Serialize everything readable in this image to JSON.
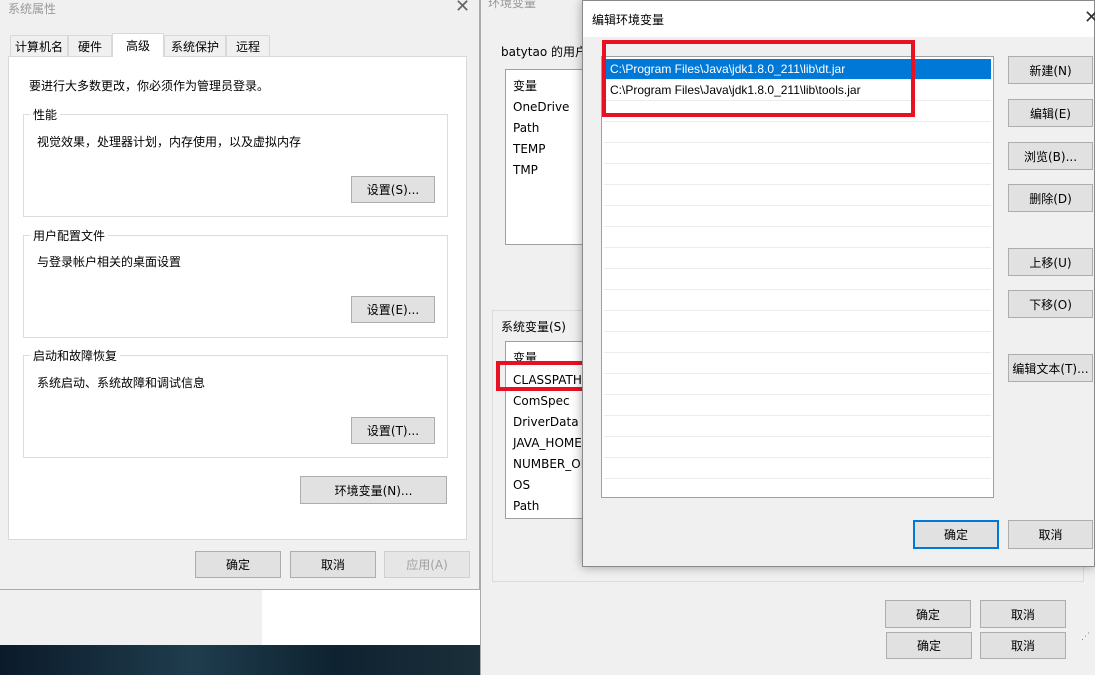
{
  "sys_props": {
    "title": "系统属性",
    "tabs": [
      "计算机名",
      "硬件",
      "高级",
      "系统保护",
      "远程"
    ],
    "notice": "要进行大多数更改，你必须作为管理员登录。",
    "performance": {
      "title": "性能",
      "desc": "视觉效果，处理器计划，内存使用，以及虚拟内存",
      "button": "设置(S)..."
    },
    "profile": {
      "title": "用户配置文件",
      "desc": "与登录帐户相关的桌面设置",
      "button": "设置(E)..."
    },
    "startup": {
      "title": "启动和故障恢复",
      "desc": "系统启动、系统故障和调试信息",
      "button": "设置(T)..."
    },
    "env_button": "环境变量(N)...",
    "ok": "确定",
    "cancel": "取消",
    "apply": "应用(A)"
  },
  "env_vars": {
    "title": "环境变量",
    "user_group": "batytao 的用户",
    "user_header": "变量",
    "user_vars": [
      "OneDrive",
      "Path",
      "TEMP",
      "TMP"
    ],
    "sys_group": "系统变量(S)",
    "sys_header": "变量",
    "sys_vars": [
      "CLASSPATH",
      "ComSpec",
      "DriverData",
      "JAVA_HOME",
      "NUMBER_OF",
      "OS",
      "Path"
    ],
    "ok": "确定",
    "cancel": "取消",
    "ok_shadow": "确定",
    "cancel_shadow": "取消"
  },
  "edit_dialog": {
    "title": "编辑环境变量",
    "entries": [
      "C:\\Program Files\\Java\\jdk1.8.0_211\\lib\\dt.jar",
      "C:\\Program Files\\Java\\jdk1.8.0_211\\lib\\tools.jar"
    ],
    "buttons": {
      "new": "新建(N)",
      "edit": "编辑(E)",
      "browse": "浏览(B)...",
      "delete": "删除(D)",
      "move_up": "上移(U)",
      "move_down": "下移(O)",
      "edit_text": "编辑文本(T)..."
    },
    "ok": "确定",
    "cancel": "取消"
  },
  "colors": {
    "highlight": "#e81123",
    "selection": "#0078d7"
  }
}
